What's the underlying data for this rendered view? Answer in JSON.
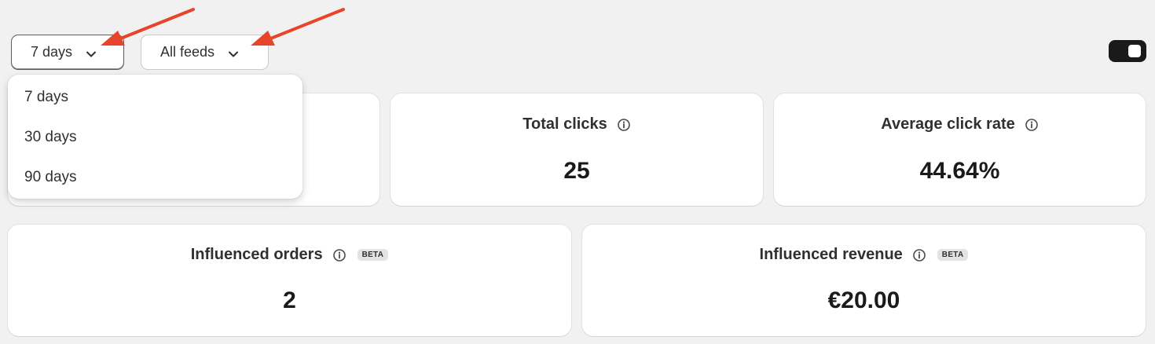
{
  "filters": {
    "days_label": "7 days",
    "feeds_label": "All feeds"
  },
  "dropdown": {
    "options": [
      "7 days",
      "30 days",
      "90 days"
    ]
  },
  "metrics": [
    {
      "title": "",
      "value": ""
    },
    {
      "title": "Total clicks",
      "value": "25"
    },
    {
      "title": "Average click rate",
      "value": "44.64%"
    },
    {
      "title": "Influenced orders",
      "value": "2",
      "badge": "BETA"
    },
    {
      "title": "Influenced revenue",
      "value": "€20.00",
      "badge": "BETA"
    }
  ],
  "icons": {
    "chevron": "chevron-down-icon",
    "info": "info-icon",
    "arrow": "red-annotation-arrow"
  },
  "colors": {
    "background": "#f1f1f1",
    "annotation_arrow": "#e8442b",
    "toggle": "#1a1a1a",
    "badge": "#e3e3e3"
  }
}
